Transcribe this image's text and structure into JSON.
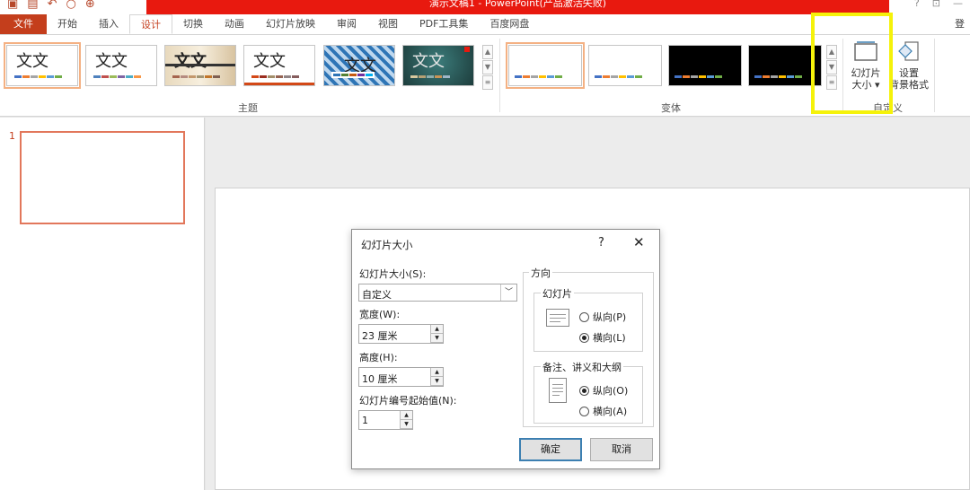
{
  "titlebar": {
    "title": "演示文稿1 - PowerPoint(产品激活失败)",
    "help": "?",
    "minimize": "—"
  },
  "tabs": {
    "items": [
      "文件",
      "开始",
      "插入",
      "设计",
      "切换",
      "动画",
      "幻灯片放映",
      "审阅",
      "视图",
      "PDF工具集",
      "百度网盘"
    ],
    "active_index": 3,
    "right_text": "登"
  },
  "ribbon": {
    "themes_group_label": "主题",
    "theme_tile_text": "文文",
    "variants_group_label": "变体",
    "custom_group_label": "自定义",
    "slide_size_button": {
      "line1": "幻灯片",
      "line2": "大小"
    },
    "format_background_button": {
      "line1": "设置",
      "line2": "背景格式"
    }
  },
  "thumbnails": {
    "slide_number": "1"
  },
  "dialog": {
    "title": "幻灯片大小",
    "help": "?",
    "close": "✕",
    "slide_size_label": "幻灯片大小(S):",
    "slide_size_value": "自定义",
    "width_label": "宽度(W):",
    "width_value": "23 厘米",
    "height_label": "高度(H):",
    "height_value": "10 厘米",
    "start_number_label": "幻灯片编号起始值(N):",
    "start_number_value": "1",
    "orientation_label": "方向",
    "slides_group": "幻灯片",
    "slides_portrait": "纵向(P)",
    "slides_landscape": "横向(L)",
    "slides_selected": "landscape",
    "notes_group": "备注、讲义和大纲",
    "notes_portrait": "纵向(O)",
    "notes_landscape": "横向(A)",
    "notes_selected": "portrait",
    "ok": "确定",
    "cancel": "取消"
  },
  "colors": {
    "accent": "#c43e1c",
    "title_red": "#e8190f",
    "highlight": "#f5f20a"
  }
}
